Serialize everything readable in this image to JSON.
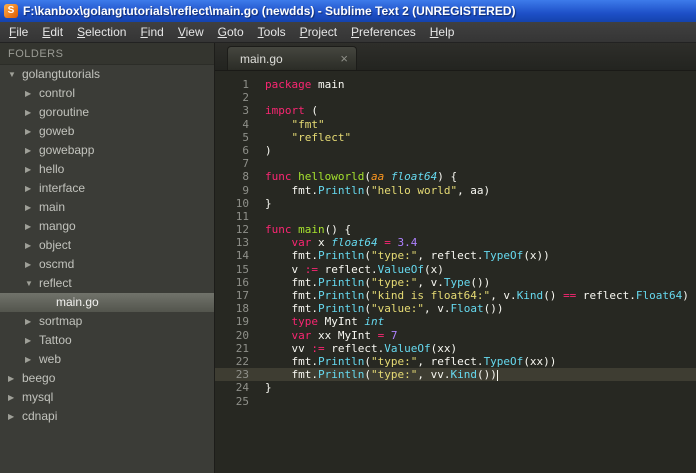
{
  "window": {
    "title": "F:\\kanbox\\golangtutorials\\reflect\\main.go (newdds) - Sublime Text 2 (UNREGISTERED)",
    "app_icon_letter": "S"
  },
  "menu": {
    "items": [
      "File",
      "Edit",
      "Selection",
      "Find",
      "View",
      "Goto",
      "Tools",
      "Project",
      "Preferences",
      "Help"
    ]
  },
  "sidebar": {
    "header": "FOLDERS",
    "items": [
      {
        "label": "golangtutorials",
        "indent": 0,
        "type": "folder",
        "expanded": true,
        "selected": false
      },
      {
        "label": "control",
        "indent": 1,
        "type": "folder",
        "expanded": false,
        "selected": false
      },
      {
        "label": "goroutine",
        "indent": 1,
        "type": "folder",
        "expanded": false,
        "selected": false
      },
      {
        "label": "goweb",
        "indent": 1,
        "type": "folder",
        "expanded": false,
        "selected": false
      },
      {
        "label": "gowebapp",
        "indent": 1,
        "type": "folder",
        "expanded": false,
        "selected": false
      },
      {
        "label": "hello",
        "indent": 1,
        "type": "folder",
        "expanded": false,
        "selected": false
      },
      {
        "label": "interface",
        "indent": 1,
        "type": "folder",
        "expanded": false,
        "selected": false
      },
      {
        "label": "main",
        "indent": 1,
        "type": "folder",
        "expanded": false,
        "selected": false
      },
      {
        "label": "mango",
        "indent": 1,
        "type": "folder",
        "expanded": false,
        "selected": false
      },
      {
        "label": "object",
        "indent": 1,
        "type": "folder",
        "expanded": false,
        "selected": false
      },
      {
        "label": "oscmd",
        "indent": 1,
        "type": "folder",
        "expanded": false,
        "selected": false
      },
      {
        "label": "reflect",
        "indent": 1,
        "type": "folder",
        "expanded": true,
        "selected": false
      },
      {
        "label": "main.go",
        "indent": 2,
        "type": "file",
        "expanded": false,
        "selected": true
      },
      {
        "label": "sortmap",
        "indent": 1,
        "type": "folder",
        "expanded": false,
        "selected": false
      },
      {
        "label": "Tattoo",
        "indent": 1,
        "type": "folder",
        "expanded": false,
        "selected": false
      },
      {
        "label": "web",
        "indent": 1,
        "type": "folder",
        "expanded": false,
        "selected": false
      },
      {
        "label": "beego",
        "indent": 0,
        "type": "folder",
        "expanded": false,
        "selected": false
      },
      {
        "label": "mysql",
        "indent": 0,
        "type": "folder",
        "expanded": false,
        "selected": false
      },
      {
        "label": "cdnapi",
        "indent": 0,
        "type": "folder",
        "expanded": false,
        "selected": false
      }
    ]
  },
  "tab": {
    "label": "main.go",
    "close_label": "×"
  },
  "editor": {
    "cursor_line": 23,
    "colors": {
      "kw": "#f92672",
      "fn": "#a6e22e",
      "type": "#66d9ef",
      "call": "#66d9ef",
      "str": "#e6db74",
      "num": "#ae81ff",
      "param": "#fd971f",
      "pl": "#f8f8f2"
    },
    "lines": [
      {
        "n": 1,
        "tokens": [
          {
            "t": "package",
            "c": "kw"
          },
          {
            "t": " main",
            "c": "pl"
          }
        ]
      },
      {
        "n": 2,
        "tokens": []
      },
      {
        "n": 3,
        "tokens": [
          {
            "t": "import",
            "c": "kw"
          },
          {
            "t": " (",
            "c": "pl"
          }
        ]
      },
      {
        "n": 4,
        "tokens": [
          {
            "t": "    ",
            "c": "pl"
          },
          {
            "t": "\"fmt\"",
            "c": "str"
          }
        ]
      },
      {
        "n": 5,
        "tokens": [
          {
            "t": "    ",
            "c": "pl"
          },
          {
            "t": "\"reflect\"",
            "c": "str"
          }
        ]
      },
      {
        "n": 6,
        "tokens": [
          {
            "t": ")",
            "c": "pl"
          }
        ]
      },
      {
        "n": 7,
        "tokens": []
      },
      {
        "n": 8,
        "tokens": [
          {
            "t": "func",
            "c": "kw"
          },
          {
            "t": " ",
            "c": "pl"
          },
          {
            "t": "helloworld",
            "c": "fn"
          },
          {
            "t": "(",
            "c": "pl"
          },
          {
            "t": "aa",
            "c": "param"
          },
          {
            "t": " ",
            "c": "pl"
          },
          {
            "t": "float64",
            "c": "type"
          },
          {
            "t": ") {",
            "c": "pl"
          }
        ]
      },
      {
        "n": 9,
        "tokens": [
          {
            "t": "    fmt.",
            "c": "pl"
          },
          {
            "t": "Println",
            "c": "call"
          },
          {
            "t": "(",
            "c": "pl"
          },
          {
            "t": "\"hello world\"",
            "c": "str"
          },
          {
            "t": ", aa)",
            "c": "pl"
          }
        ]
      },
      {
        "n": 10,
        "tokens": [
          {
            "t": "}",
            "c": "pl"
          }
        ]
      },
      {
        "n": 11,
        "tokens": []
      },
      {
        "n": 12,
        "tokens": [
          {
            "t": "func",
            "c": "kw"
          },
          {
            "t": " ",
            "c": "pl"
          },
          {
            "t": "main",
            "c": "fn"
          },
          {
            "t": "() {",
            "c": "pl"
          }
        ]
      },
      {
        "n": 13,
        "tokens": [
          {
            "t": "    ",
            "c": "pl"
          },
          {
            "t": "var",
            "c": "kw"
          },
          {
            "t": " x ",
            "c": "pl"
          },
          {
            "t": "float64",
            "c": "type"
          },
          {
            "t": " ",
            "c": "pl"
          },
          {
            "t": "=",
            "c": "kw"
          },
          {
            "t": " ",
            "c": "pl"
          },
          {
            "t": "3.4",
            "c": "num"
          }
        ]
      },
      {
        "n": 14,
        "tokens": [
          {
            "t": "    fmt.",
            "c": "pl"
          },
          {
            "t": "Println",
            "c": "call"
          },
          {
            "t": "(",
            "c": "pl"
          },
          {
            "t": "\"type:\"",
            "c": "str"
          },
          {
            "t": ", reflect.",
            "c": "pl"
          },
          {
            "t": "TypeOf",
            "c": "call"
          },
          {
            "t": "(x))",
            "c": "pl"
          }
        ]
      },
      {
        "n": 15,
        "tokens": [
          {
            "t": "    v ",
            "c": "pl"
          },
          {
            "t": ":=",
            "c": "kw"
          },
          {
            "t": " reflect.",
            "c": "pl"
          },
          {
            "t": "ValueOf",
            "c": "call"
          },
          {
            "t": "(x)",
            "c": "pl"
          }
        ]
      },
      {
        "n": 16,
        "tokens": [
          {
            "t": "    fmt.",
            "c": "pl"
          },
          {
            "t": "Println",
            "c": "call"
          },
          {
            "t": "(",
            "c": "pl"
          },
          {
            "t": "\"type:\"",
            "c": "str"
          },
          {
            "t": ", v.",
            "c": "pl"
          },
          {
            "t": "Type",
            "c": "call"
          },
          {
            "t": "())",
            "c": "pl"
          }
        ]
      },
      {
        "n": 17,
        "tokens": [
          {
            "t": "    fmt.",
            "c": "pl"
          },
          {
            "t": "Println",
            "c": "call"
          },
          {
            "t": "(",
            "c": "pl"
          },
          {
            "t": "\"kind is float64:\"",
            "c": "str"
          },
          {
            "t": ", v.",
            "c": "pl"
          },
          {
            "t": "Kind",
            "c": "call"
          },
          {
            "t": "() ",
            "c": "pl"
          },
          {
            "t": "==",
            "c": "kw"
          },
          {
            "t": " reflect.",
            "c": "pl"
          },
          {
            "t": "Float64",
            "c": "call"
          },
          {
            "t": ")",
            "c": "pl"
          }
        ]
      },
      {
        "n": 18,
        "tokens": [
          {
            "t": "    fmt.",
            "c": "pl"
          },
          {
            "t": "Println",
            "c": "call"
          },
          {
            "t": "(",
            "c": "pl"
          },
          {
            "t": "\"value:\"",
            "c": "str"
          },
          {
            "t": ", v.",
            "c": "pl"
          },
          {
            "t": "Float",
            "c": "call"
          },
          {
            "t": "())",
            "c": "pl"
          }
        ]
      },
      {
        "n": 19,
        "tokens": [
          {
            "t": "    ",
            "c": "pl"
          },
          {
            "t": "type",
            "c": "kw"
          },
          {
            "t": " MyInt ",
            "c": "pl"
          },
          {
            "t": "int",
            "c": "type"
          }
        ]
      },
      {
        "n": 20,
        "tokens": [
          {
            "t": "    ",
            "c": "pl"
          },
          {
            "t": "var",
            "c": "kw"
          },
          {
            "t": " xx MyInt ",
            "c": "pl"
          },
          {
            "t": "=",
            "c": "kw"
          },
          {
            "t": " ",
            "c": "pl"
          },
          {
            "t": "7",
            "c": "num"
          }
        ]
      },
      {
        "n": 21,
        "tokens": [
          {
            "t": "    vv ",
            "c": "pl"
          },
          {
            "t": ":=",
            "c": "kw"
          },
          {
            "t": " reflect.",
            "c": "pl"
          },
          {
            "t": "ValueOf",
            "c": "call"
          },
          {
            "t": "(xx)",
            "c": "pl"
          }
        ]
      },
      {
        "n": 22,
        "tokens": [
          {
            "t": "    fmt.",
            "c": "pl"
          },
          {
            "t": "Println",
            "c": "call"
          },
          {
            "t": "(",
            "c": "pl"
          },
          {
            "t": "\"type:\"",
            "c": "str"
          },
          {
            "t": ", reflect.",
            "c": "pl"
          },
          {
            "t": "TypeOf",
            "c": "call"
          },
          {
            "t": "(xx))",
            "c": "pl"
          }
        ]
      },
      {
        "n": 23,
        "tokens": [
          {
            "t": "    fmt.",
            "c": "pl"
          },
          {
            "t": "Println",
            "c": "call"
          },
          {
            "t": "(",
            "c": "pl"
          },
          {
            "t": "\"type:\"",
            "c": "str"
          },
          {
            "t": ", vv.",
            "c": "pl"
          },
          {
            "t": "Kind",
            "c": "call"
          },
          {
            "t": "())",
            "c": "pl"
          }
        ]
      },
      {
        "n": 24,
        "tokens": [
          {
            "t": "}",
            "c": "pl"
          }
        ]
      },
      {
        "n": 25,
        "tokens": []
      }
    ]
  }
}
